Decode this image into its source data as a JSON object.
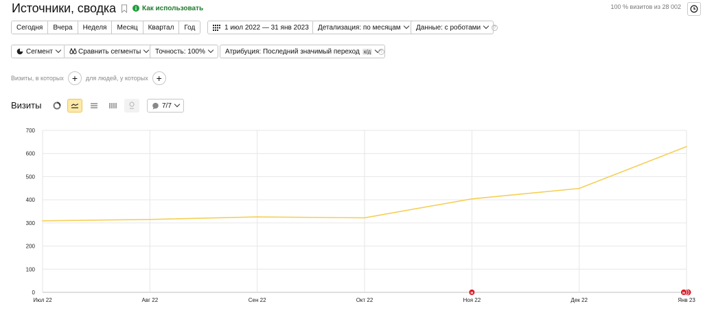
{
  "header": {
    "title": "Источники, сводка",
    "howto_label": "Как использовать",
    "visits_summary": "100 % визитов из 28 002"
  },
  "toolbar": {
    "periods": [
      "Сегодня",
      "Вчера",
      "Неделя",
      "Месяц",
      "Квартал",
      "Год"
    ],
    "date_range": "1 июл 2022 — 31 янв 2023",
    "detail": "Детализация: по месяцам",
    "data": "Данные: с роботами"
  },
  "toolbar2": {
    "segment": "Сегмент",
    "compare": "Сравнить сегменты",
    "accuracy": "Точность: 100%",
    "attribution": "Атрибуция: Последний значимый переход",
    "attribution_badge": "к/д"
  },
  "filters": {
    "visits_label": "Визиты, в которых",
    "people_label": "для людей, у которых"
  },
  "chart_section": {
    "title": "Визиты",
    "series_count": "7/7"
  },
  "colors": {
    "line": "#f5cf55",
    "grid": "#e6e6e6",
    "marker": "#d81b28",
    "active_tool": "#fde9a8"
  },
  "chart_data": {
    "type": "line",
    "categories": [
      "Июл 22",
      "Авг 22",
      "Сен 22",
      "Окт 22",
      "Ноя 22",
      "Дек 22",
      "Янв 23"
    ],
    "series": [
      {
        "values": [
          309,
          315,
          326,
          322,
          404,
          449,
          630
        ]
      }
    ],
    "ylim": [
      0,
      700
    ],
    "yticks": [
      0,
      100,
      200,
      300,
      400,
      500,
      600,
      700
    ],
    "grid": true,
    "annotations": [
      {
        "category": "Ноя 22",
        "label": "н"
      },
      {
        "category": "Янв 23",
        "label": "н"
      }
    ]
  }
}
